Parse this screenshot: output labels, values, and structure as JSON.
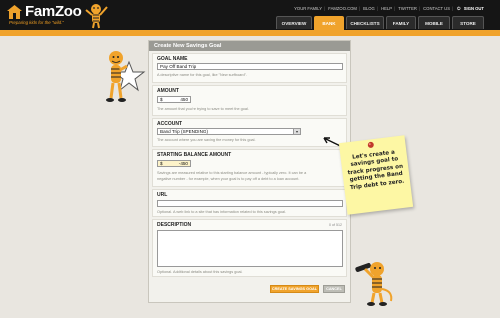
{
  "header": {
    "logo_text": "FamZoo",
    "tagline": "Preparing kids for the \"wild.\"",
    "links": [
      "YOUR FAMILY",
      "FAMZOO.COM",
      "BLOG",
      "HELP",
      "TWITTER",
      "CONTACT US"
    ],
    "signout": "SIGN OUT"
  },
  "tabs": [
    {
      "label": "OVERVIEW"
    },
    {
      "label": "BANK"
    },
    {
      "label": "CHECKLISTS"
    },
    {
      "label": "FAMILY"
    },
    {
      "label": "MOBILE"
    },
    {
      "label": "STORE"
    }
  ],
  "form": {
    "title": "Create New Savings Goal",
    "goal_name": {
      "label": "GOAL NAME",
      "value": "Pay Off Band Trip",
      "help": "A descriptive name for this goal, like \"New surfboard\"."
    },
    "amount": {
      "label": "AMOUNT",
      "prefix": "$",
      "value": "450",
      "help": "The amount that you're trying to save to meet the goal."
    },
    "account": {
      "label": "ACCOUNT",
      "value": "Band Trip (SPENDING)",
      "help": "The account where you are saving the money for this goal."
    },
    "starting_balance": {
      "label": "STARTING BALANCE AMOUNT",
      "prefix": "$",
      "value": "-450",
      "help_line1": "Savings are measured relative to this starting balance amount - typically zero. It can be a",
      "help_line2": "negative number - for example, when your goal is to pay off a debt to a loan account."
    },
    "url": {
      "label": "URL",
      "value": "",
      "help": "Optional. A web link to a site that has information related to this savings goal."
    },
    "description": {
      "label": "DESCRIPTION",
      "counter": "0 of 512",
      "value": "",
      "help": "Optional. Additional details about this savings goal."
    },
    "create_button": "CREATE SAVINGS GOAL",
    "cancel_button": "CANCEL"
  },
  "note": {
    "text": "Let's create a savings goal to track progress on getting the Band Trip debt to zero."
  },
  "colors": {
    "accent": "#f0a32c",
    "topbar": "#151515",
    "card_header": "#9a9a94",
    "note": "#fdf7a4"
  }
}
